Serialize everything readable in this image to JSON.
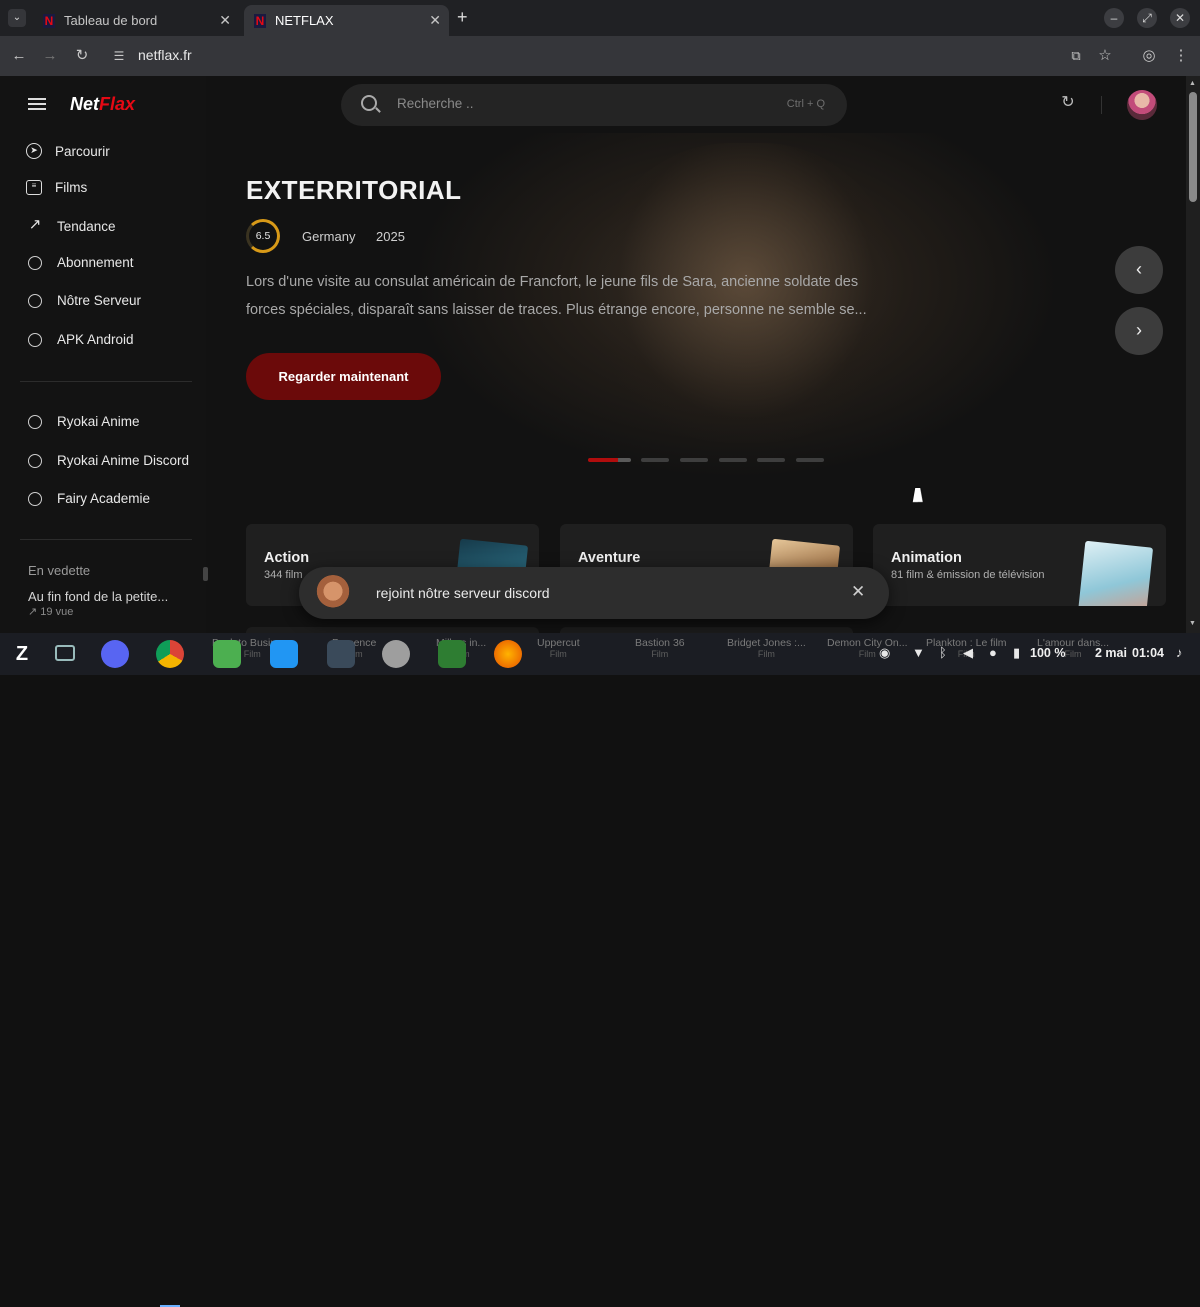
{
  "browser": {
    "tabs": [
      {
        "title": "Tableau de bord",
        "favicon": "netflax-favicon",
        "active": false
      },
      {
        "title": "NETFLAX",
        "favicon": "netflax-favicon",
        "active": true
      }
    ],
    "new_tab_label": "+",
    "url": "netflax.fr"
  },
  "sidebar": {
    "logo_left": "Net",
    "logo_right": "Flax",
    "items": [
      {
        "label": "Parcourir",
        "icon": "compass-icon"
      },
      {
        "label": "Films",
        "icon": "film-icon"
      },
      {
        "label": "Tendance",
        "icon": "trending-icon"
      },
      {
        "label": "Abonnement",
        "icon": "circle-icon"
      },
      {
        "label": "Nôtre Serveur",
        "icon": "circle-icon"
      },
      {
        "label": "APK Android",
        "icon": "circle-icon"
      }
    ],
    "links": [
      {
        "label": "Ryokai Anime"
      },
      {
        "label": "Ryokai Anime Discord"
      },
      {
        "label": "Fairy Academie"
      }
    ],
    "featured": {
      "title": "En vedette",
      "item": "Au fin fond de la petite...",
      "views": "19 vue"
    }
  },
  "header": {
    "search_placeholder": "Recherche ..",
    "search_shortcut": "Ctrl + Q"
  },
  "hero": {
    "title": "EXTERRITORIAL",
    "rating": "6.5",
    "rating_fraction": 0.65,
    "country": "Germany",
    "year": "2025",
    "description": "Lors d'une visite au consulat américain de Francfort, le jeune fils de Sara, ancienne soldate des forces spéciales, disparaît sans laisser de traces. Plus étrange encore, personne ne semble se...",
    "cta": "Regarder maintenant",
    "slides_total": 6,
    "slide_active": 1
  },
  "genres": [
    {
      "name": "Action",
      "count": "344 film"
    },
    {
      "name": "Aventure",
      "count": ""
    },
    {
      "name": "Animation",
      "count": "81 film & émission de télévision"
    }
  ],
  "toast": {
    "text": "rejoint nôtre serveur discord"
  },
  "taskbar": {
    "ghost_items": [
      {
        "title": "Back to Business",
        "sub": "Film"
      },
      {
        "title": "Presence",
        "sub": "Film"
      },
      {
        "title": "Millers in...",
        "sub": "Film"
      },
      {
        "title": "Uppercut",
        "sub": "Film"
      },
      {
        "title": "Bastion 36",
        "sub": "Film"
      },
      {
        "title": "Bridget Jones :...",
        "sub": "Film"
      },
      {
        "title": "Demon City On...",
        "sub": "Film"
      },
      {
        "title": "Plankton : Le film",
        "sub": "Film"
      },
      {
        "title": "L'amour dans...",
        "sub": "Film"
      }
    ],
    "battery": "100 %",
    "date": "2 mai",
    "time": "01:04"
  },
  "colors": {
    "brand_red": "#e50914",
    "cta_bg": "#6b0a0a",
    "rating_ring": "#d89a18",
    "background": "#121212"
  }
}
